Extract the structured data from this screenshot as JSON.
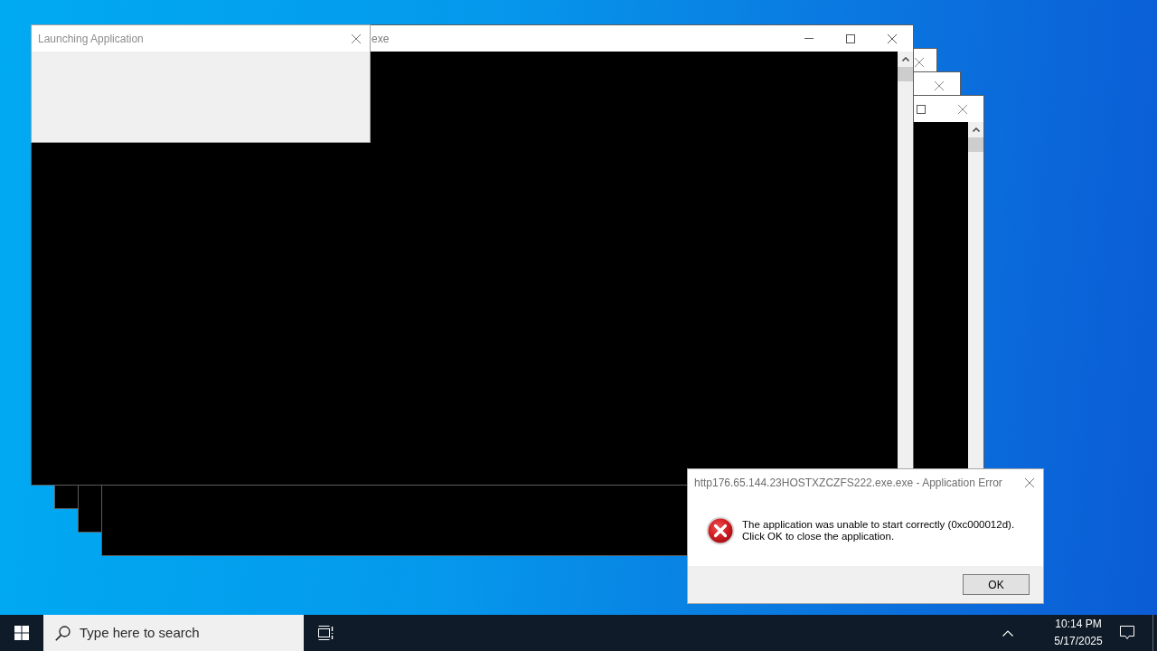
{
  "console_windows": [
    {
      "title": "exe",
      "buttons": [
        {
          "kind": "minimize"
        },
        {
          "kind": "maximize"
        },
        {
          "kind": "close"
        }
      ],
      "scrollbar": true
    },
    {
      "buttons": [
        {
          "kind": "close"
        }
      ]
    },
    {
      "buttons": [
        {
          "kind": "close"
        }
      ]
    },
    {
      "buttons": [
        {
          "kind": "maximize"
        },
        {
          "kind": "close"
        }
      ],
      "scrollbar": true
    }
  ],
  "launch_window": {
    "title": "Launching Application"
  },
  "error_dialog": {
    "title": "http176.65.144.23HOSTXZCZFS222.exe.exe - Application Error",
    "message": "The application was unable to start correctly (0xc000012d).\nClick OK to close the application.",
    "buttons": [
      "OK"
    ]
  },
  "taskbar": {
    "search": {
      "placeholder": "Type here to search"
    },
    "clock": {
      "time": "10:14 PM",
      "date": "5/17/2025"
    }
  }
}
